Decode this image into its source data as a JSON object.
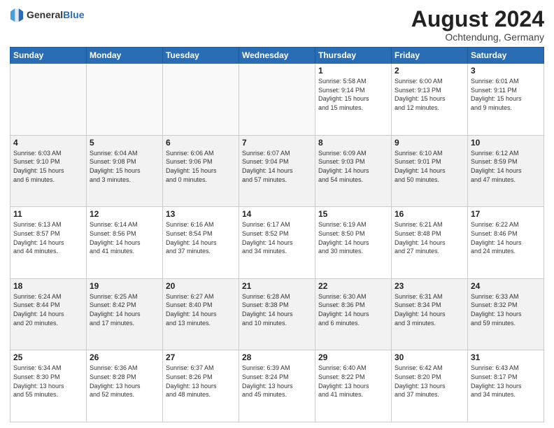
{
  "header": {
    "logo_general": "General",
    "logo_blue": "Blue",
    "month_year": "August 2024",
    "location": "Ochtendung, Germany"
  },
  "weekdays": [
    "Sunday",
    "Monday",
    "Tuesday",
    "Wednesday",
    "Thursday",
    "Friday",
    "Saturday"
  ],
  "weeks": [
    [
      {
        "day": "",
        "info": ""
      },
      {
        "day": "",
        "info": ""
      },
      {
        "day": "",
        "info": ""
      },
      {
        "day": "",
        "info": ""
      },
      {
        "day": "1",
        "info": "Sunrise: 5:58 AM\nSunset: 9:14 PM\nDaylight: 15 hours\nand 15 minutes."
      },
      {
        "day": "2",
        "info": "Sunrise: 6:00 AM\nSunset: 9:13 PM\nDaylight: 15 hours\nand 12 minutes."
      },
      {
        "day": "3",
        "info": "Sunrise: 6:01 AM\nSunset: 9:11 PM\nDaylight: 15 hours\nand 9 minutes."
      }
    ],
    [
      {
        "day": "4",
        "info": "Sunrise: 6:03 AM\nSunset: 9:10 PM\nDaylight: 15 hours\nand 6 minutes."
      },
      {
        "day": "5",
        "info": "Sunrise: 6:04 AM\nSunset: 9:08 PM\nDaylight: 15 hours\nand 3 minutes."
      },
      {
        "day": "6",
        "info": "Sunrise: 6:06 AM\nSunset: 9:06 PM\nDaylight: 15 hours\nand 0 minutes."
      },
      {
        "day": "7",
        "info": "Sunrise: 6:07 AM\nSunset: 9:04 PM\nDaylight: 14 hours\nand 57 minutes."
      },
      {
        "day": "8",
        "info": "Sunrise: 6:09 AM\nSunset: 9:03 PM\nDaylight: 14 hours\nand 54 minutes."
      },
      {
        "day": "9",
        "info": "Sunrise: 6:10 AM\nSunset: 9:01 PM\nDaylight: 14 hours\nand 50 minutes."
      },
      {
        "day": "10",
        "info": "Sunrise: 6:12 AM\nSunset: 8:59 PM\nDaylight: 14 hours\nand 47 minutes."
      }
    ],
    [
      {
        "day": "11",
        "info": "Sunrise: 6:13 AM\nSunset: 8:57 PM\nDaylight: 14 hours\nand 44 minutes."
      },
      {
        "day": "12",
        "info": "Sunrise: 6:14 AM\nSunset: 8:56 PM\nDaylight: 14 hours\nand 41 minutes."
      },
      {
        "day": "13",
        "info": "Sunrise: 6:16 AM\nSunset: 8:54 PM\nDaylight: 14 hours\nand 37 minutes."
      },
      {
        "day": "14",
        "info": "Sunrise: 6:17 AM\nSunset: 8:52 PM\nDaylight: 14 hours\nand 34 minutes."
      },
      {
        "day": "15",
        "info": "Sunrise: 6:19 AM\nSunset: 8:50 PM\nDaylight: 14 hours\nand 30 minutes."
      },
      {
        "day": "16",
        "info": "Sunrise: 6:21 AM\nSunset: 8:48 PM\nDaylight: 14 hours\nand 27 minutes."
      },
      {
        "day": "17",
        "info": "Sunrise: 6:22 AM\nSunset: 8:46 PM\nDaylight: 14 hours\nand 24 minutes."
      }
    ],
    [
      {
        "day": "18",
        "info": "Sunrise: 6:24 AM\nSunset: 8:44 PM\nDaylight: 14 hours\nand 20 minutes."
      },
      {
        "day": "19",
        "info": "Sunrise: 6:25 AM\nSunset: 8:42 PM\nDaylight: 14 hours\nand 17 minutes."
      },
      {
        "day": "20",
        "info": "Sunrise: 6:27 AM\nSunset: 8:40 PM\nDaylight: 14 hours\nand 13 minutes."
      },
      {
        "day": "21",
        "info": "Sunrise: 6:28 AM\nSunset: 8:38 PM\nDaylight: 14 hours\nand 10 minutes."
      },
      {
        "day": "22",
        "info": "Sunrise: 6:30 AM\nSunset: 8:36 PM\nDaylight: 14 hours\nand 6 minutes."
      },
      {
        "day": "23",
        "info": "Sunrise: 6:31 AM\nSunset: 8:34 PM\nDaylight: 14 hours\nand 3 minutes."
      },
      {
        "day": "24",
        "info": "Sunrise: 6:33 AM\nSunset: 8:32 PM\nDaylight: 13 hours\nand 59 minutes."
      }
    ],
    [
      {
        "day": "25",
        "info": "Sunrise: 6:34 AM\nSunset: 8:30 PM\nDaylight: 13 hours\nand 55 minutes."
      },
      {
        "day": "26",
        "info": "Sunrise: 6:36 AM\nSunset: 8:28 PM\nDaylight: 13 hours\nand 52 minutes."
      },
      {
        "day": "27",
        "info": "Sunrise: 6:37 AM\nSunset: 8:26 PM\nDaylight: 13 hours\nand 48 minutes."
      },
      {
        "day": "28",
        "info": "Sunrise: 6:39 AM\nSunset: 8:24 PM\nDaylight: 13 hours\nand 45 minutes."
      },
      {
        "day": "29",
        "info": "Sunrise: 6:40 AM\nSunset: 8:22 PM\nDaylight: 13 hours\nand 41 minutes."
      },
      {
        "day": "30",
        "info": "Sunrise: 6:42 AM\nSunset: 8:20 PM\nDaylight: 13 hours\nand 37 minutes."
      },
      {
        "day": "31",
        "info": "Sunrise: 6:43 AM\nSunset: 8:17 PM\nDaylight: 13 hours\nand 34 minutes."
      }
    ]
  ]
}
